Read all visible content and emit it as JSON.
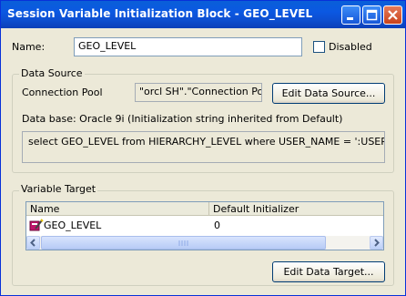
{
  "window": {
    "title": "Session Variable Initialization Block - GEO_LEVEL"
  },
  "name_row": {
    "label": "Name:",
    "value": "GEO_LEVEL",
    "disabled_label": "Disabled",
    "disabled_checked": false
  },
  "data_source": {
    "legend": "Data Source",
    "connection_pool_label": "Connection Pool",
    "connection_pool_value": "\"orcl SH\".\"Connection Pool\"",
    "edit_button": "Edit Data Source...",
    "database_info": "Data base: Oracle 9i (Initialization string inherited from Default)",
    "sql": "select GEO_LEVEL from HIERARCHY_LEVEL where USER_NAME = ':USER'"
  },
  "variable_target": {
    "legend": "Variable Target",
    "columns": [
      "Name",
      "Default Initializer"
    ],
    "rows": [
      {
        "name": "GEO_LEVEL",
        "default": "0",
        "icon": "variable-icon"
      }
    ],
    "edit_button": "Edit Data Target..."
  },
  "icons": {
    "minimize": "minimize-icon",
    "maximize": "maximize-icon",
    "close": "close-icon"
  }
}
